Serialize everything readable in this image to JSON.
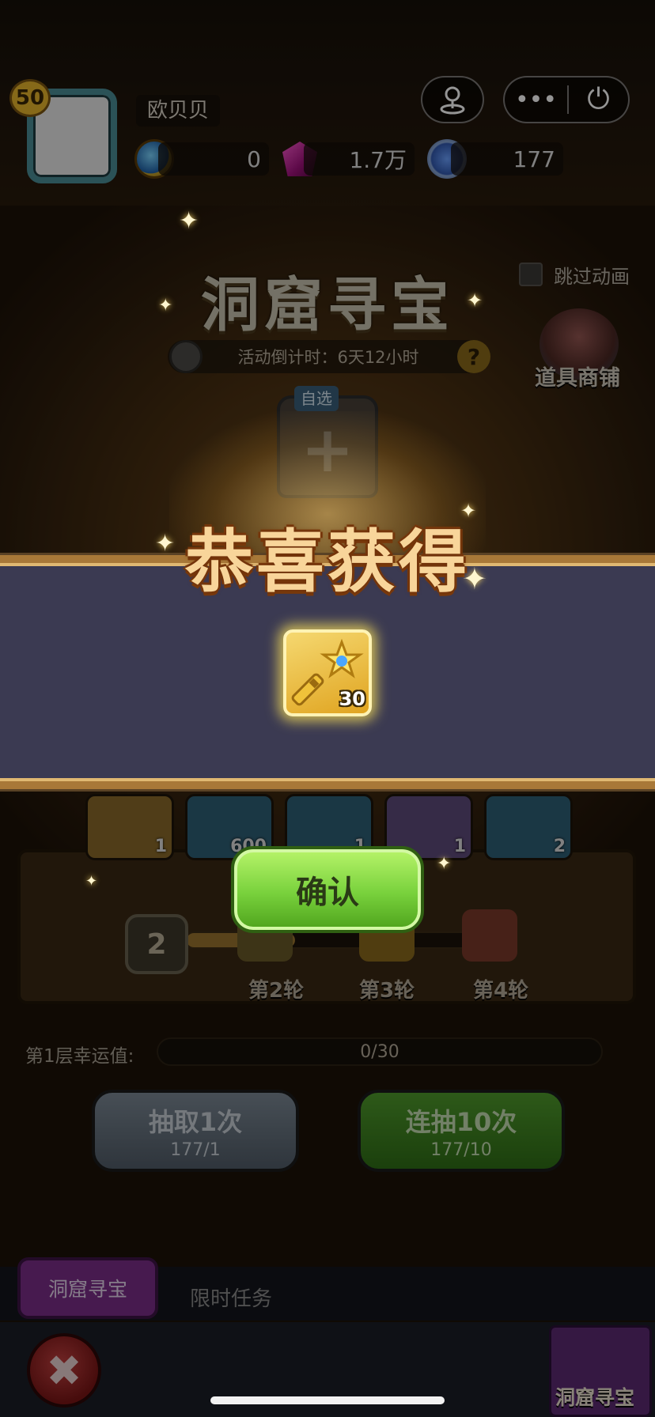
{
  "player": {
    "level": "50",
    "name": "欧贝贝"
  },
  "resources": [
    {
      "icon": "coin-icon",
      "value": "0"
    },
    {
      "icon": "gem-icon",
      "value": "1.7万"
    },
    {
      "icon": "ticket-icon",
      "value": "177"
    }
  ],
  "event": {
    "title": "洞窟寻宝",
    "countdown": "活动倒计时：6天12小时",
    "help": "?",
    "skip_animation": "跳过动画",
    "shop": "道具商铺",
    "slot_tag": "自选",
    "slot_plus": "+"
  },
  "item_cards": [
    {
      "qty": "1",
      "color": "#8a6a2a"
    },
    {
      "qty": "600",
      "color": "#2e5f75"
    },
    {
      "qty": "1",
      "color": "#2e5f75"
    },
    {
      "qty": "1",
      "color": "#5e4a7a"
    },
    {
      "qty": "2",
      "color": "#2e5f75"
    }
  ],
  "rounds": {
    "current": "2",
    "progress": 0.33,
    "labels": [
      "第2轮",
      "第3轮",
      "第4轮"
    ]
  },
  "luck": {
    "label": "第1层幸运值:",
    "value": "0/30"
  },
  "draw_buttons": {
    "single": {
      "label": "抽取1次",
      "cost": "177/1"
    },
    "ten": {
      "label": "连抽10次",
      "cost": "177/10"
    }
  },
  "tabs": {
    "active": "洞窟寻宝",
    "other": "限时任务"
  },
  "close": "✖",
  "corner_label": "洞窟寻宝",
  "popup": {
    "title": "恭喜获得",
    "item": {
      "name": "star-key",
      "qty": "30"
    },
    "confirm": "确认"
  },
  "capsule": {
    "more": "•••",
    "power": "⏻"
  },
  "colors": {
    "accent_green": "#78d13c",
    "popup_band": "#3b3a52",
    "gold_border": "#a87838"
  }
}
